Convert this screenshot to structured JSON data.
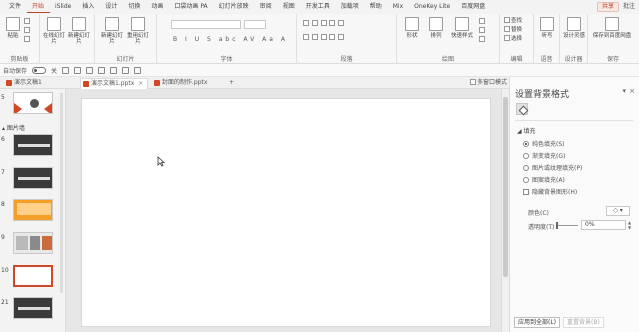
{
  "menu": {
    "items": [
      "文件",
      "开始",
      "iSlide",
      "插入",
      "设计",
      "切换",
      "动画",
      "口袋动画 PA",
      "幻灯片放映",
      "审阅",
      "视图",
      "开发工具",
      "加载项",
      "帮助",
      "Mix",
      "OneKey Lite",
      "百度网盘"
    ],
    "active_index": 1,
    "share_label": "共享",
    "comment_label": "批注"
  },
  "ribbon": {
    "groups": {
      "clipboard": "剪贴板",
      "slides": "幻灯片",
      "font": "字体",
      "paragraph": "段落",
      "drawing": "绘图",
      "editing": "编辑",
      "voice": "语音",
      "designer": "设计器",
      "save": "保存"
    },
    "buttons": {
      "paste": "粘贴",
      "online_slides": "在线幻灯片",
      "new_from_online": "新建幻灯片",
      "new_slide": "新建幻灯片",
      "reuse_slides": "重用幻灯片",
      "shapes": "形状",
      "arrange": "排列",
      "quick_styles": "快速样式",
      "find": "查找",
      "replace": "替换",
      "select": "选择",
      "dictate": "听写",
      "design_ideas": "设计灵感",
      "save_to_baidu": "保存到百度网盘"
    },
    "format_symbols": "B I U S abc AV Aa A"
  },
  "qat": {
    "autosave_label": "自动保存",
    "autosave_state": "关"
  },
  "tabs": [
    {
      "label": "演示文稿1",
      "active": false
    },
    {
      "label": "演示文稿1.pptx",
      "active": true
    },
    {
      "label": "封面的制作.pptx",
      "active": false
    }
  ],
  "tabs_add": "+",
  "multi_window_label": "多窗口模式",
  "thumbnails": {
    "section_label": "图片墙",
    "slide_numbers": [
      "5",
      "6",
      "7",
      "8",
      "9",
      "10",
      "21"
    ]
  },
  "format_pane": {
    "title": "设置背景格式",
    "section": "填充",
    "options": [
      {
        "label": "纯色填充(S)",
        "selected": true
      },
      {
        "label": "渐变填充(G)",
        "selected": false
      },
      {
        "label": "图片或纹理填充(P)",
        "selected": false
      },
      {
        "label": "图案填充(A)",
        "selected": false
      }
    ],
    "hide_graphics_label": "隐藏背景图形(H)",
    "color_label": "颜色(C)",
    "transparency_label": "透明度(T)",
    "transparency_value": "0%",
    "transparency": 0,
    "apply_all_label": "应用到全部(L)",
    "reset_label": "重置背景(B)"
  }
}
